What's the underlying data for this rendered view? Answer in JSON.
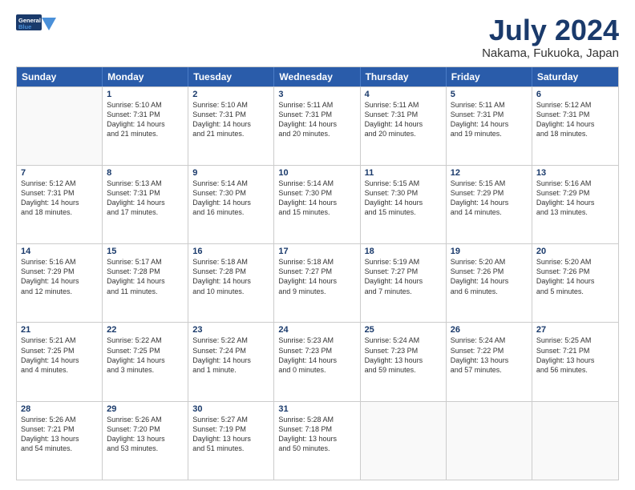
{
  "logo": {
    "line1": "General",
    "line2": "Blue"
  },
  "title": "July 2024",
  "subtitle": "Nakama, Fukuoka, Japan",
  "header_days": [
    "Sunday",
    "Monday",
    "Tuesday",
    "Wednesday",
    "Thursday",
    "Friday",
    "Saturday"
  ],
  "weeks": [
    [
      {
        "day": "",
        "lines": []
      },
      {
        "day": "1",
        "lines": [
          "Sunrise: 5:10 AM",
          "Sunset: 7:31 PM",
          "Daylight: 14 hours",
          "and 21 minutes."
        ]
      },
      {
        "day": "2",
        "lines": [
          "Sunrise: 5:10 AM",
          "Sunset: 7:31 PM",
          "Daylight: 14 hours",
          "and 21 minutes."
        ]
      },
      {
        "day": "3",
        "lines": [
          "Sunrise: 5:11 AM",
          "Sunset: 7:31 PM",
          "Daylight: 14 hours",
          "and 20 minutes."
        ]
      },
      {
        "day": "4",
        "lines": [
          "Sunrise: 5:11 AM",
          "Sunset: 7:31 PM",
          "Daylight: 14 hours",
          "and 20 minutes."
        ]
      },
      {
        "day": "5",
        "lines": [
          "Sunrise: 5:11 AM",
          "Sunset: 7:31 PM",
          "Daylight: 14 hours",
          "and 19 minutes."
        ]
      },
      {
        "day": "6",
        "lines": [
          "Sunrise: 5:12 AM",
          "Sunset: 7:31 PM",
          "Daylight: 14 hours",
          "and 18 minutes."
        ]
      }
    ],
    [
      {
        "day": "7",
        "lines": [
          "Sunrise: 5:12 AM",
          "Sunset: 7:31 PM",
          "Daylight: 14 hours",
          "and 18 minutes."
        ]
      },
      {
        "day": "8",
        "lines": [
          "Sunrise: 5:13 AM",
          "Sunset: 7:31 PM",
          "Daylight: 14 hours",
          "and 17 minutes."
        ]
      },
      {
        "day": "9",
        "lines": [
          "Sunrise: 5:14 AM",
          "Sunset: 7:30 PM",
          "Daylight: 14 hours",
          "and 16 minutes."
        ]
      },
      {
        "day": "10",
        "lines": [
          "Sunrise: 5:14 AM",
          "Sunset: 7:30 PM",
          "Daylight: 14 hours",
          "and 15 minutes."
        ]
      },
      {
        "day": "11",
        "lines": [
          "Sunrise: 5:15 AM",
          "Sunset: 7:30 PM",
          "Daylight: 14 hours",
          "and 15 minutes."
        ]
      },
      {
        "day": "12",
        "lines": [
          "Sunrise: 5:15 AM",
          "Sunset: 7:29 PM",
          "Daylight: 14 hours",
          "and 14 minutes."
        ]
      },
      {
        "day": "13",
        "lines": [
          "Sunrise: 5:16 AM",
          "Sunset: 7:29 PM",
          "Daylight: 14 hours",
          "and 13 minutes."
        ]
      }
    ],
    [
      {
        "day": "14",
        "lines": [
          "Sunrise: 5:16 AM",
          "Sunset: 7:29 PM",
          "Daylight: 14 hours",
          "and 12 minutes."
        ]
      },
      {
        "day": "15",
        "lines": [
          "Sunrise: 5:17 AM",
          "Sunset: 7:28 PM",
          "Daylight: 14 hours",
          "and 11 minutes."
        ]
      },
      {
        "day": "16",
        "lines": [
          "Sunrise: 5:18 AM",
          "Sunset: 7:28 PM",
          "Daylight: 14 hours",
          "and 10 minutes."
        ]
      },
      {
        "day": "17",
        "lines": [
          "Sunrise: 5:18 AM",
          "Sunset: 7:27 PM",
          "Daylight: 14 hours",
          "and 9 minutes."
        ]
      },
      {
        "day": "18",
        "lines": [
          "Sunrise: 5:19 AM",
          "Sunset: 7:27 PM",
          "Daylight: 14 hours",
          "and 7 minutes."
        ]
      },
      {
        "day": "19",
        "lines": [
          "Sunrise: 5:20 AM",
          "Sunset: 7:26 PM",
          "Daylight: 14 hours",
          "and 6 minutes."
        ]
      },
      {
        "day": "20",
        "lines": [
          "Sunrise: 5:20 AM",
          "Sunset: 7:26 PM",
          "Daylight: 14 hours",
          "and 5 minutes."
        ]
      }
    ],
    [
      {
        "day": "21",
        "lines": [
          "Sunrise: 5:21 AM",
          "Sunset: 7:25 PM",
          "Daylight: 14 hours",
          "and 4 minutes."
        ]
      },
      {
        "day": "22",
        "lines": [
          "Sunrise: 5:22 AM",
          "Sunset: 7:25 PM",
          "Daylight: 14 hours",
          "and 3 minutes."
        ]
      },
      {
        "day": "23",
        "lines": [
          "Sunrise: 5:22 AM",
          "Sunset: 7:24 PM",
          "Daylight: 14 hours",
          "and 1 minute."
        ]
      },
      {
        "day": "24",
        "lines": [
          "Sunrise: 5:23 AM",
          "Sunset: 7:23 PM",
          "Daylight: 14 hours",
          "and 0 minutes."
        ]
      },
      {
        "day": "25",
        "lines": [
          "Sunrise: 5:24 AM",
          "Sunset: 7:23 PM",
          "Daylight: 13 hours",
          "and 59 minutes."
        ]
      },
      {
        "day": "26",
        "lines": [
          "Sunrise: 5:24 AM",
          "Sunset: 7:22 PM",
          "Daylight: 13 hours",
          "and 57 minutes."
        ]
      },
      {
        "day": "27",
        "lines": [
          "Sunrise: 5:25 AM",
          "Sunset: 7:21 PM",
          "Daylight: 13 hours",
          "and 56 minutes."
        ]
      }
    ],
    [
      {
        "day": "28",
        "lines": [
          "Sunrise: 5:26 AM",
          "Sunset: 7:21 PM",
          "Daylight: 13 hours",
          "and 54 minutes."
        ]
      },
      {
        "day": "29",
        "lines": [
          "Sunrise: 5:26 AM",
          "Sunset: 7:20 PM",
          "Daylight: 13 hours",
          "and 53 minutes."
        ]
      },
      {
        "day": "30",
        "lines": [
          "Sunrise: 5:27 AM",
          "Sunset: 7:19 PM",
          "Daylight: 13 hours",
          "and 51 minutes."
        ]
      },
      {
        "day": "31",
        "lines": [
          "Sunrise: 5:28 AM",
          "Sunset: 7:18 PM",
          "Daylight: 13 hours",
          "and 50 minutes."
        ]
      },
      {
        "day": "",
        "lines": []
      },
      {
        "day": "",
        "lines": []
      },
      {
        "day": "",
        "lines": []
      }
    ]
  ]
}
